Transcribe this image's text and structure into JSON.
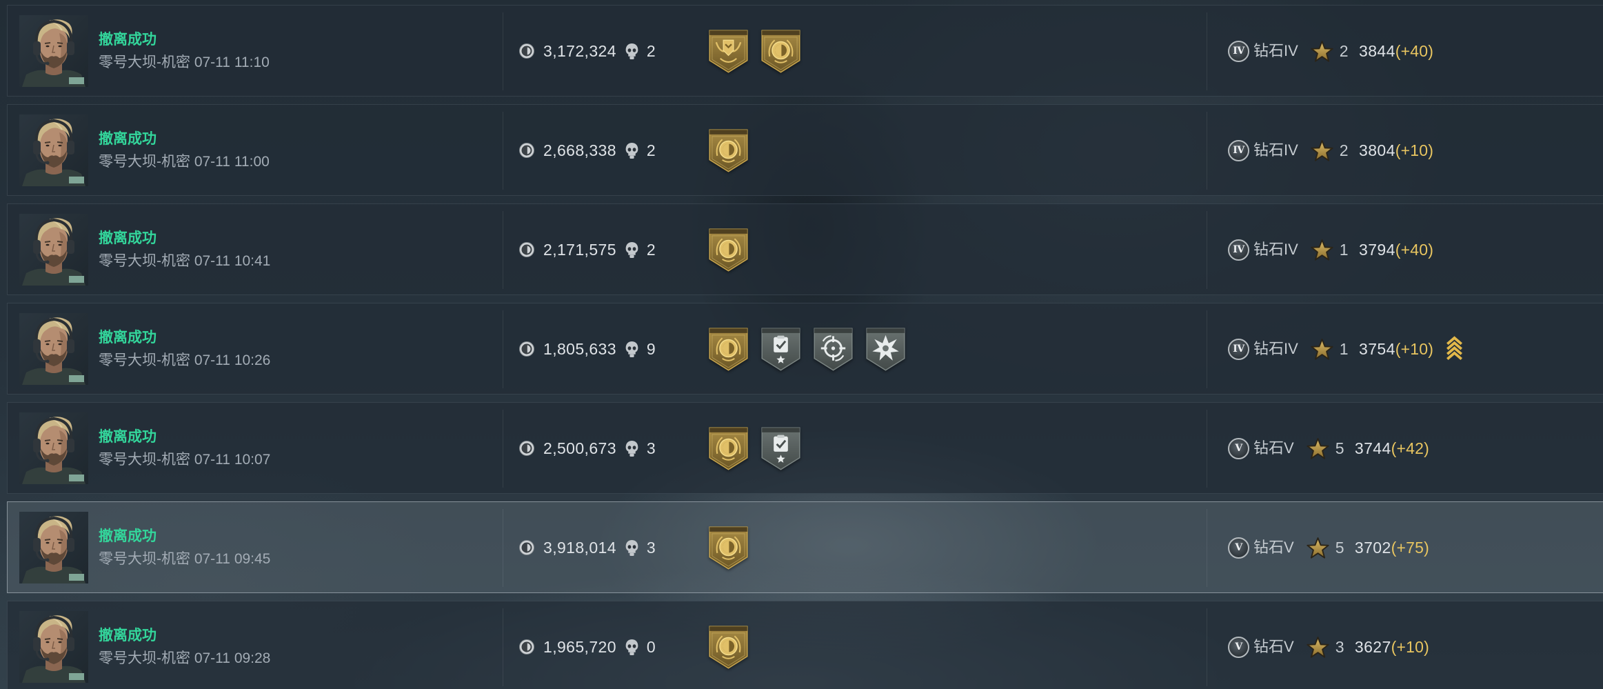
{
  "colors": {
    "status_success": "#33d69b",
    "score_delta": "#e8c560",
    "value_text": "#dfe3e7",
    "muted_text": "#a3acb5",
    "selected_row": "#4a545c"
  },
  "icons": {
    "avatar": "operator-portrait",
    "loot_value": "coin-icon",
    "kills": "skull-icon",
    "stars": "star-icon",
    "rank_up": "rank-up-chevrons-icon"
  },
  "rows": [
    {
      "status": "撤离成功",
      "subtitle": "零号大坝-机密 07-11 11:10",
      "value": "3,172,324",
      "kills": "2",
      "badges": [
        "gold-shield-badge",
        "gold-emblem-badge"
      ],
      "rank_numeral": "IV",
      "rank": "钻石IV",
      "stars": "2",
      "score": "3844",
      "delta": "(+40)",
      "rank_up": false,
      "selected": false
    },
    {
      "status": "撤离成功",
      "subtitle": "零号大坝-机密 07-11 11:00",
      "value": "2,668,338",
      "kills": "2",
      "badges": [
        "gold-emblem-badge"
      ],
      "rank_numeral": "IV",
      "rank": "钻石IV",
      "stars": "2",
      "score": "3804",
      "delta": "(+10)",
      "rank_up": false,
      "selected": false
    },
    {
      "status": "撤离成功",
      "subtitle": "零号大坝-机密 07-11 10:41",
      "value": "2,171,575",
      "kills": "2",
      "badges": [
        "gold-emblem-badge"
      ],
      "rank_numeral": "IV",
      "rank": "钻石IV",
      "stars": "1",
      "score": "3794",
      "delta": "(+40)",
      "rank_up": false,
      "selected": false
    },
    {
      "status": "撤离成功",
      "subtitle": "零号大坝-机密 07-11 10:26",
      "value": "1,805,633",
      "kills": "9",
      "badges": [
        "gold-emblem-badge",
        "check-star-badge",
        "crosshair-badge",
        "explosion-badge"
      ],
      "rank_numeral": "IV",
      "rank": "钻石IV",
      "stars": "1",
      "score": "3754",
      "delta": "(+10)",
      "rank_up": true,
      "selected": false
    },
    {
      "status": "撤离成功",
      "subtitle": "零号大坝-机密 07-11 10:07",
      "value": "2,500,673",
      "kills": "3",
      "badges": [
        "gold-emblem-badge",
        "check-star-badge"
      ],
      "rank_numeral": "V",
      "rank": "钻石V",
      "stars": "5",
      "score": "3744",
      "delta": "(+42)",
      "rank_up": false,
      "selected": false
    },
    {
      "status": "撤离成功",
      "subtitle": "零号大坝-机密 07-11 09:45",
      "value": "3,918,014",
      "kills": "3",
      "badges": [
        "gold-emblem-badge"
      ],
      "rank_numeral": "V",
      "rank": "钻石V",
      "stars": "5",
      "score": "3702",
      "delta": "(+75)",
      "rank_up": false,
      "selected": true
    },
    {
      "status": "撤离成功",
      "subtitle": "零号大坝-机密 07-11 09:28",
      "value": "1,965,720",
      "kills": "0",
      "badges": [
        "gold-emblem-badge"
      ],
      "rank_numeral": "V",
      "rank": "钻石V",
      "stars": "3",
      "score": "3627",
      "delta": "(+10)",
      "rank_up": false,
      "selected": false
    }
  ]
}
